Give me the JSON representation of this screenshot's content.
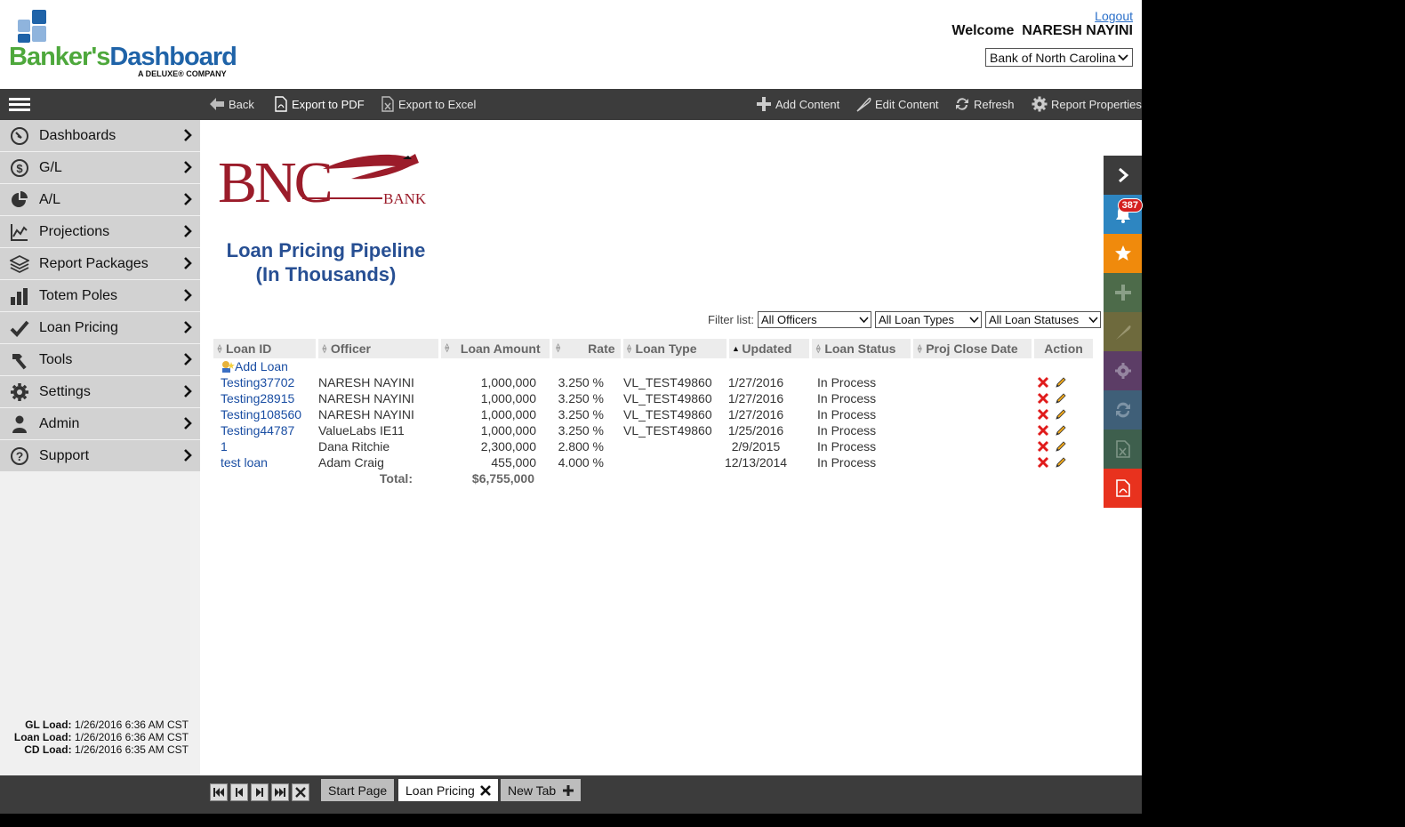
{
  "header": {
    "brand_part1": "Banker's",
    "brand_part2": "Dashboard",
    "brand_tagline": "A DELUXE® COMPANY",
    "logout": "Logout",
    "welcome": "Welcome  NARESH NAYINI",
    "bank_selected": "Bank of North Carolina"
  },
  "toolbar": {
    "back": "Back",
    "export_pdf": "Export to PDF",
    "export_excel": "Export to Excel",
    "add_content": "Add Content",
    "edit_content": "Edit Content",
    "refresh": "Refresh",
    "report_properties": "Report Properties"
  },
  "sidebar": {
    "items": [
      {
        "label": "Dashboards",
        "icon": "compass-icon"
      },
      {
        "label": "G/L",
        "icon": "dollar-icon"
      },
      {
        "label": "A/L",
        "icon": "pie-icon"
      },
      {
        "label": "Projections",
        "icon": "line-chart-icon"
      },
      {
        "label": "Report Packages",
        "icon": "layers-icon"
      },
      {
        "label": "Totem Poles",
        "icon": "bar-chart-icon"
      },
      {
        "label": "Loan Pricing",
        "icon": "checkmark-icon"
      },
      {
        "label": "Tools",
        "icon": "hammer-icon"
      },
      {
        "label": "Settings",
        "icon": "gear-icon"
      },
      {
        "label": "Admin",
        "icon": "user-icon"
      },
      {
        "label": "Support",
        "icon": "question-icon"
      }
    ],
    "loads": {
      "gl_label": "GL Load:",
      "gl_value": "1/26/2016 6:36 AM CST",
      "loan_label": "Loan Load:",
      "loan_value": "1/26/2016 6:36 AM CST",
      "cd_label": "CD Load:",
      "cd_value": "1/26/2016 6:35 AM CST"
    }
  },
  "report": {
    "bank_logo_text": "BNC",
    "bank_logo_sub": "BANK",
    "title_line1": "Loan Pricing Pipeline",
    "title_line2": "(In Thousands)",
    "filter_label": "Filter list:",
    "filters": {
      "officers": "All Officers",
      "loan_types": "All Loan Types",
      "loan_statuses": "All Loan Statuses"
    },
    "columns": {
      "loan_id": "Loan ID",
      "officer": "Officer",
      "loan_amount": "Loan Amount",
      "rate": "Rate",
      "loan_type": "Loan Type",
      "updated": "Updated",
      "loan_status": "Loan Status",
      "proj_close_date": "Proj Close Date",
      "action": "Action"
    },
    "add_loan": "Add Loan",
    "rows": [
      {
        "loan_id": "Testing37702",
        "officer": "NARESH NAYINI",
        "amount": "1,000,000",
        "rate": "3.250 %",
        "type": "VL_TEST49860",
        "updated": "1/27/2016",
        "status": "In Process",
        "proj_close": ""
      },
      {
        "loan_id": "Testing28915",
        "officer": "NARESH NAYINI",
        "amount": "1,000,000",
        "rate": "3.250 %",
        "type": "VL_TEST49860",
        "updated": "1/27/2016",
        "status": "In Process",
        "proj_close": ""
      },
      {
        "loan_id": "Testing108560",
        "officer": "NARESH NAYINI",
        "amount": "1,000,000",
        "rate": "3.250 %",
        "type": "VL_TEST49860",
        "updated": "1/27/2016",
        "status": "In Process",
        "proj_close": ""
      },
      {
        "loan_id": "Testing44787",
        "officer": "ValueLabs IE11",
        "amount": "1,000,000",
        "rate": "3.250 %",
        "type": "VL_TEST49860",
        "updated": "1/25/2016",
        "status": "In Process",
        "proj_close": ""
      },
      {
        "loan_id": "1",
        "officer": "Dana Ritchie",
        "amount": "2,300,000",
        "rate": "2.800 %",
        "type": "",
        "updated": "2/9/2015",
        "status": "In Process",
        "proj_close": ""
      },
      {
        "loan_id": "test loan",
        "officer": "Adam Craig",
        "amount": "455,000",
        "rate": "4.000 %",
        "type": "",
        "updated": "12/13/2014",
        "status": "In Process",
        "proj_close": ""
      }
    ],
    "total_label": "Total:",
    "total_value": "$6,755,000"
  },
  "rail": {
    "notifications_count": "387",
    "colors": {
      "collapse": "#3c3c3c",
      "notifications": "#2e86c1",
      "favorites": "#f08a0c",
      "add": "#4d6b4a",
      "edit": "#6e6a3d",
      "settings": "#5c3d66",
      "refresh": "#3f5f78",
      "excel": "#3e5f4d",
      "pdf": "#e8321e"
    }
  },
  "tabs": {
    "items": [
      "Start Page",
      "Loan Pricing",
      "New Tab"
    ]
  }
}
